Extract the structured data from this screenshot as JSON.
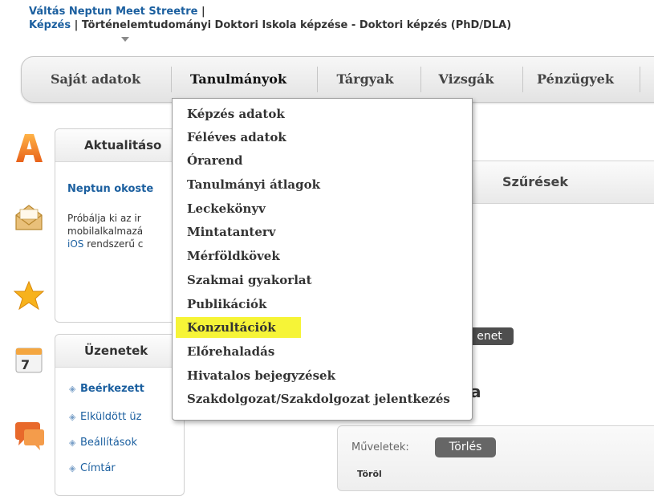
{
  "header": {
    "switch_link": "Váltás Neptun Meet Streetre",
    "sep1": " |",
    "training_label": "Képzés",
    "sep2": " | ",
    "training_value": "Történelemtudományi Doktori Iskola képzése - Doktori képzés (PhD/DLA)"
  },
  "menubar": {
    "items": [
      "Saját adatok",
      "Tanulmányok",
      "Tárgyak",
      "Vizsgák",
      "Pénzügyek"
    ],
    "active": "Tanulmányok"
  },
  "dropdown": {
    "items": [
      "Képzés adatok",
      "Féléves adatok",
      "Órarend",
      "Tanulmányi átlagok",
      "Leckekönyv",
      "Mintatanterv",
      "Mérföldkövek",
      "Szakmai gyakorlat",
      "Publikációk",
      "Konzultációk",
      "Előrehaladás",
      "Hivatalos bejegyzések",
      "Szakdolgozat/Szakdolgozat jelentkezés"
    ],
    "highlighted": "Konzultációk"
  },
  "news": {
    "title": "Aktualitáso",
    "item_title": "Neptun okoste",
    "line1": "Próbálja ki az ir",
    "line2": "mobilalkalmazá",
    "line3_link": "iOS",
    "line3_rest": " rendszerű c"
  },
  "messages": {
    "title": "Üzenetek",
    "items": [
      "Beérkezett",
      "Elküldött üz",
      "Beállítások",
      "Címtár"
    ]
  },
  "filters": {
    "title": "Szűrések",
    "colon": ":",
    "button_label": "enet",
    "big_letter": "a"
  },
  "operations": {
    "label": "Műveletek:",
    "delete_button": "Törlés",
    "delete_column": "Töröl"
  },
  "colors": {
    "link_blue": "#1b5f9f",
    "highlight": "#f6f437",
    "dark_button": "#4e4e4e"
  },
  "icons": [
    "a-letter-icon",
    "envelope-icon",
    "star-icon",
    "calendar-icon",
    "chat-bubble-icon"
  ]
}
